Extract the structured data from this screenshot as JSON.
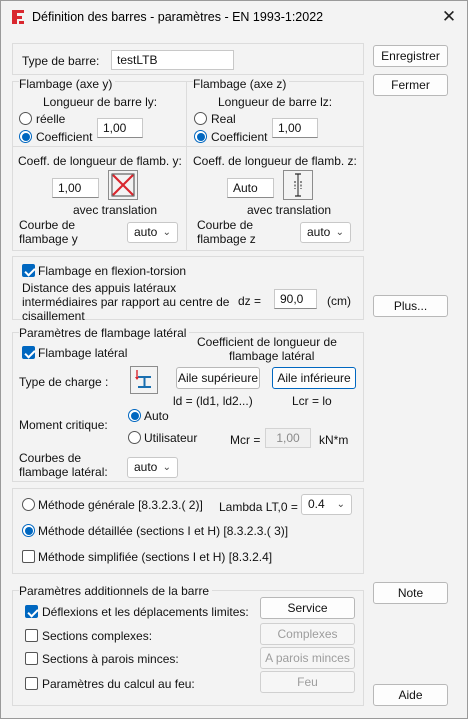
{
  "window": {
    "title": "Définition des barres - paramètres - EN 1993-1:2022",
    "close_glyph": "✕"
  },
  "bar_type": {
    "label": "Type de barre:",
    "value": "testLTB"
  },
  "right_buttons": {
    "save": "Enregistrer",
    "close": "Fermer",
    "more": "Plus...",
    "note": "Note",
    "help": "Aide"
  },
  "buckling_y": {
    "title": "Flambage (axe y)",
    "length_label": "Longueur de barre ly:",
    "opt_real": "réelle",
    "opt_coef": "Coefficient",
    "coef_value": "1,00",
    "coef_length_label": "Coeff. de longueur de flamb. y:",
    "coef_length_value": "1,00",
    "translation_label": "avec translation",
    "curve_label_1": "Courbe de",
    "curve_label_2": "flambage  y",
    "curve_value": "auto"
  },
  "buckling_z": {
    "title": "Flambage (axe z)",
    "length_label": "Longueur de barre lz:",
    "opt_real": "Real",
    "opt_coef": "Coefficient",
    "coef_value": "1,00",
    "coef_length_label": "Coeff. de longueur de flamb. z:",
    "coef_length_value": "Auto",
    "translation_label": "avec translation",
    "curve_label_1": "Courbe de",
    "curve_label_2": "flambage  z",
    "curve_value": "auto"
  },
  "torsional": {
    "check_label": "Flambage en flexion-torsion",
    "dist_line1": "Distance des appuis latéraux",
    "dist_line2": "intermédiaires par rapport au centre de",
    "dist_line3": "cisaillement",
    "dz_label": "dz =",
    "dz_value": "90,0",
    "dz_unit": "(cm)"
  },
  "lateral": {
    "title": "Paramètres de flambage latéral",
    "check_label": "Flambage latéral",
    "coef_title_1": "Coefficient de longueur de",
    "coef_title_2": "flambage latéral",
    "load_type_label": "Type de charge :",
    "upper_flange": "Aile supérieure",
    "lower_flange": "Aile inférieure",
    "ld_formula": "ld = (ld1, ld2...)",
    "lcr_formula": "Lcr =  lo",
    "moment_label": "Moment critique:",
    "opt_auto": "Auto",
    "opt_user": "Utilisateur",
    "mcr_label": "Mcr =",
    "mcr_value": "1,00",
    "mcr_unit": "kN*m",
    "curves_label_1": "Courbes de",
    "curves_label_2": "flambage latéral:",
    "curves_value": "auto"
  },
  "methods": {
    "general": "Méthode générale [8.3.2.3.( 2)]",
    "detailed": "Méthode détaillée (sections I et H) [8.3.2.3.( 3)]",
    "simplified": "Méthode simplifiée (sections I et H) [8.3.2.4]",
    "lambda_label": "Lambda LT,0 =",
    "lambda_value": "0.4"
  },
  "additional": {
    "title": "Paramètres additionnels de la barre",
    "deflection": "Déflexions et les déplacements limites:",
    "complex": "Sections complexes:",
    "thin": "Sections à parois minces:",
    "fire": "Paramètres du calcul au feu:",
    "service_btn": "Service",
    "complex_btn": "Complexes",
    "thin_btn": "A parois minces",
    "fire_btn": "Feu"
  },
  "icons": {
    "app": "robot-app-icon",
    "buckling_y": "cross-sway-icon",
    "buckling_z": "non-sway-column-icon",
    "load_type": "i-beam-load-icon"
  },
  "colors": {
    "accent": "#0067c0",
    "red": "#d9272e",
    "window_bg": "#f3f3f3"
  }
}
